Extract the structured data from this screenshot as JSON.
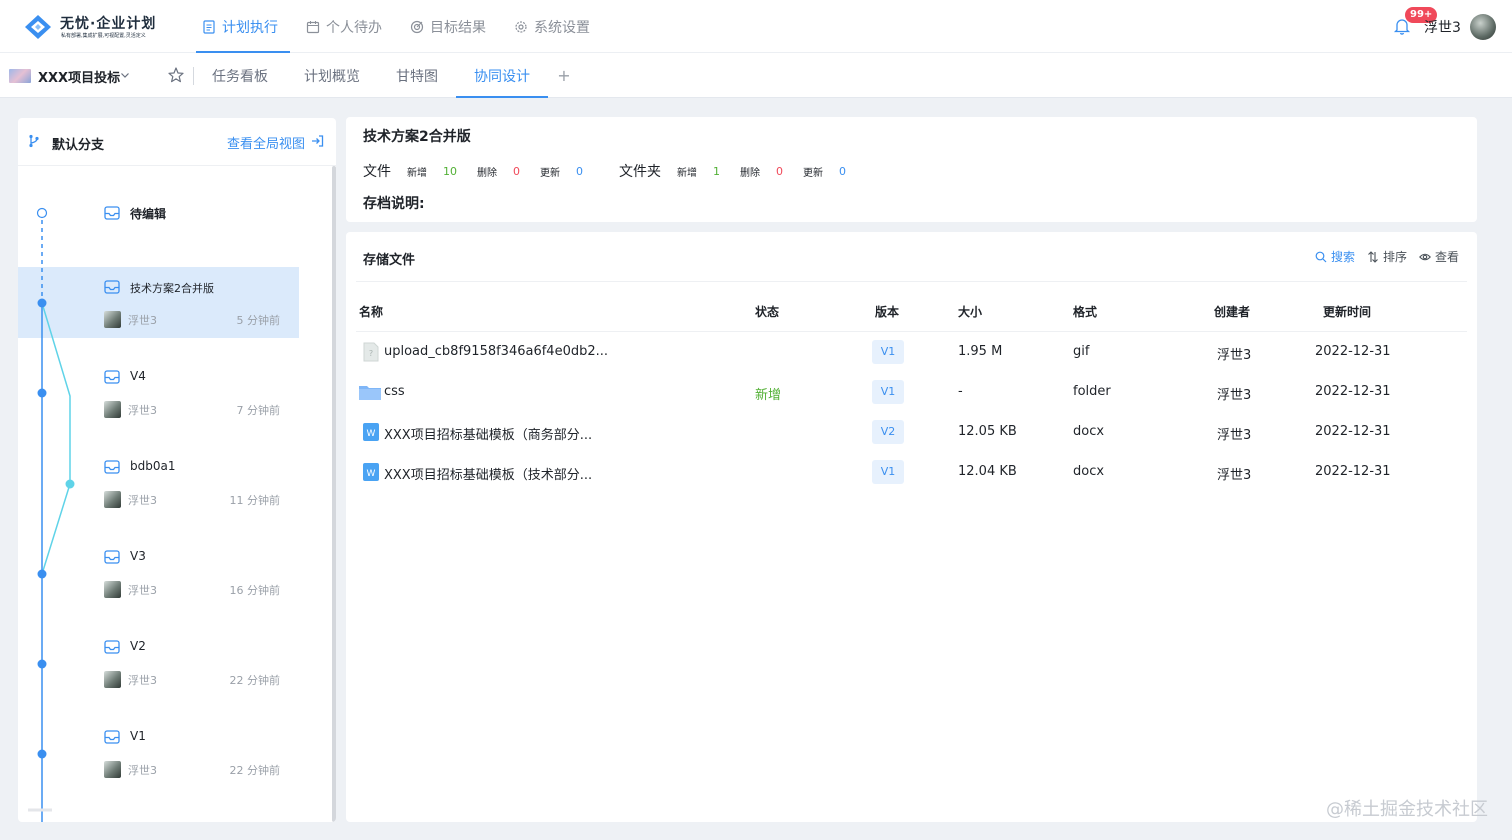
{
  "app": {
    "logo_title": "无忧·企业计划",
    "logo_subtitle": "私有部署,集成扩展,可视配置,灵活定义"
  },
  "main_nav": [
    {
      "label": "计划执行",
      "icon": "document-icon",
      "active": true
    },
    {
      "label": "个人待办",
      "icon": "calendar-icon",
      "active": false
    },
    {
      "label": "目标结果",
      "icon": "target-icon",
      "active": false
    },
    {
      "label": "系统设置",
      "icon": "gear-icon",
      "active": false
    }
  ],
  "user": {
    "name": "浮世3",
    "notification_count": "99+"
  },
  "project": {
    "name": "XXX项目投标"
  },
  "sub_nav": [
    {
      "label": "任务看板",
      "active": false
    },
    {
      "label": "计划概览",
      "active": false
    },
    {
      "label": "甘特图",
      "active": false
    },
    {
      "label": "协同设计",
      "active": true
    }
  ],
  "sub_nav_add": "+",
  "branch": {
    "label": "默认分支",
    "global_view": "查看全局视图"
  },
  "timeline": [
    {
      "title": "待编辑",
      "user": "",
      "time": ""
    },
    {
      "title": "技术方案2合并版",
      "user": "浮世3",
      "time": "5 分钟前",
      "selected": true
    },
    {
      "title": "V4",
      "user": "浮世3",
      "time": "7 分钟前"
    },
    {
      "title": "bdb0a1",
      "user": "浮世3",
      "time": "11 分钟前"
    },
    {
      "title": "V3",
      "user": "浮世3",
      "time": "16 分钟前"
    },
    {
      "title": "V2",
      "user": "浮世3",
      "time": "22 分钟前"
    },
    {
      "title": "V1",
      "user": "浮世3",
      "time": "22 分钟前"
    }
  ],
  "info": {
    "title": "技术方案2合并版",
    "file_group": "文件",
    "folder_group": "文件夹",
    "labels": {
      "added": "新增",
      "deleted": "删除",
      "updated": "更新"
    },
    "file_stats": {
      "added": "10",
      "deleted": "0",
      "updated": "0"
    },
    "folder_stats": {
      "added": "1",
      "deleted": "0",
      "updated": "0"
    },
    "archive_label": "存档说明:"
  },
  "files": {
    "title": "存储文件",
    "actions": {
      "search": "搜索",
      "sort": "排序",
      "view": "查看"
    },
    "columns": {
      "name": "名称",
      "status": "状态",
      "version": "版本",
      "size": "大小",
      "format": "格式",
      "creator": "创建者",
      "updated": "更新时间"
    },
    "rows": [
      {
        "icon": "unknown-file-icon",
        "name": "upload_cb8f9158f346a6f4e0db2...",
        "status": "",
        "version": "V1",
        "size": "1.95 M",
        "format": "gif",
        "creator": "浮世3",
        "updated": "2022-12-31"
      },
      {
        "icon": "folder-icon",
        "name": "css",
        "status": "新增",
        "version": "V1",
        "size": "-",
        "format": "folder",
        "creator": "浮世3",
        "updated": "2022-12-31"
      },
      {
        "icon": "word-file-icon",
        "name": "XXX项目招标基础模板（商务部分...",
        "status": "",
        "version": "V2",
        "size": "12.05 KB",
        "format": "docx",
        "creator": "浮世3",
        "updated": "2022-12-31"
      },
      {
        "icon": "word-file-icon",
        "name": "XXX项目招标基础模板（技术部分...",
        "status": "",
        "version": "V1",
        "size": "12.04 KB",
        "format": "docx",
        "creator": "浮世3",
        "updated": "2022-12-31"
      }
    ]
  },
  "watermark": "@稀土掘金技术社区",
  "colors": {
    "accent": "#3a8ff0",
    "added": "#52b035",
    "deleted": "#f0495a",
    "badge": "#f0495a",
    "timeline_branch": "#5fd3e8"
  }
}
